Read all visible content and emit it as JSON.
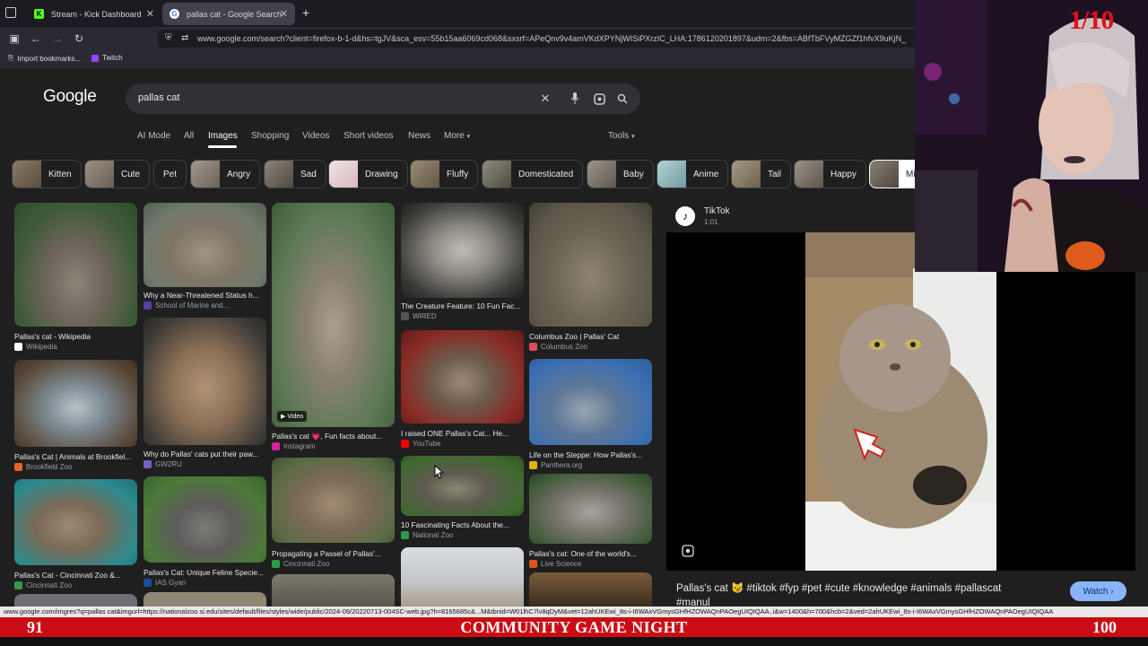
{
  "browser": {
    "tabs": [
      {
        "label": "Stream - Kick Dashboard",
        "icon": "kick-icon",
        "active": false
      },
      {
        "label": "pallas cat - Google Search",
        "icon": "google-icon",
        "active": true
      }
    ],
    "new_tab": "+",
    "url": "www.google.com/search?client=firefox-b-1-d&hs=tgJV&sca_esv=55b15aa6069cd068&sxsrf=APeQnv9v4amVKdXPYNjWISiPXrzIC_LHA:1786120201897&udm=2&fbs=ABfTbFVyMZGZf1hfvX9uKjN_",
    "bookmarks": [
      {
        "label": "Import bookmarks...",
        "icon": "import-icon"
      },
      {
        "label": "Twitch",
        "icon": "twitch-icon"
      }
    ]
  },
  "google": {
    "logo": "Google",
    "query": "pallas cat",
    "tabs": [
      "AI Mode",
      "All",
      "Images",
      "Shopping",
      "Videos",
      "Short videos",
      "News",
      "More",
      "Tools"
    ],
    "active_tab": "Images",
    "chips": [
      "Kitten",
      "Cute",
      "Pet",
      "Angry",
      "Sad",
      "Drawing",
      "Fluffy",
      "Domesticated",
      "Baby",
      "Anime",
      "Tail",
      "Happy",
      "Mi"
    ]
  },
  "results": [
    {
      "title": "Pallas's cat - Wikipedia",
      "source": "Wikipedia",
      "src_color": "#ffffff"
    },
    {
      "title": "Why a Near-Threatened Status h...",
      "source": "School of Marine and...",
      "src_color": "#5b3ea6"
    },
    {
      "title": "The Creature Feature: 10 Fun Fac...",
      "source": "WIRED",
      "src_color": "#333333"
    },
    {
      "title": "Columbus Zoo | Pallas' Cat",
      "source": "Columbus Zoo",
      "src_color": "#e34b55"
    },
    {
      "title": "Pallas's cat 💗, Fun facts about...",
      "source": "Instagram",
      "src_color": "#d6249f",
      "badge": "Video"
    },
    {
      "title": "I raised ONE Pallas's Cat... He...",
      "source": "YouTube",
      "src_color": "#ff0000"
    },
    {
      "title": "Pallas's Cat | Animals at Brookfiel...",
      "source": "Brookfield Zoo",
      "src_color": "#e8622a"
    },
    {
      "title": "Why do Pallas' cats put their paw...",
      "source": "GW2RU",
      "src_color": "#7a5ec7"
    },
    {
      "title": "Life on the Steppe: How Pallas's...",
      "source": "Panthera.org",
      "src_color": "#e2b300"
    },
    {
      "title": "10 Fascinating Facts About the...",
      "source": "National Zoo",
      "src_color": "#2e9a4a"
    },
    {
      "title": "Propagating a Passel of Pallas'...",
      "source": "Cincinnati Zoo",
      "src_color": "#2e9a4a"
    },
    {
      "title": "Pallas's Cat - Cincinnati Zoo &...",
      "source": "Cincinnati Zoo",
      "src_color": "#2e9a4a"
    },
    {
      "title": "Pallas's Cat: Unique Feline Specie...",
      "source": "IAS Gyan",
      "src_color": "#1a4fa0"
    },
    {
      "title": "Pallas's cat: One of the world's...",
      "source": "Live Science",
      "src_color": "#e0541f"
    }
  ],
  "preview": {
    "source": "TikTok",
    "duration": "1:01",
    "caption": "Pallas's cat 😼 #tiktok #fyp #pet #cute #knowledge #animals #pallascat #manul",
    "watch": "Watch"
  },
  "status_url": "www.google.com/imgres?q=pallas cat&imgurl=https://nationalzoo.si.edu/sites/default/files/styles/wide/public/2024-09/20220713-004SC-web.jpg?h=8165685c&...M&tbnid=W01lhC7lv8qDyM&vet=12ahUKEwi_8s-i-I6WAxVGmysGHfHZOWAQnPAOegUIQIQAA..i&w=1400&h=700&hcb=2&ved=2ahUKEwi_8s-i-I6WAxVGmysGHfHZOWAQnPAOegUIQIQAA",
  "stream": {
    "banner": "COMMUNITY GAME NIGHT",
    "left_count": "91",
    "right_count": "100",
    "score": "1/10"
  },
  "colors": {
    "accent": "#8ab4f8",
    "banner": "#cc0c14",
    "page_bg": "#1f1f1f"
  }
}
